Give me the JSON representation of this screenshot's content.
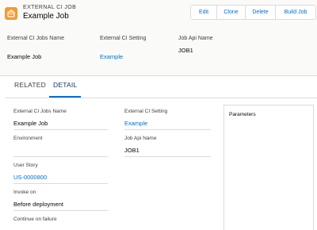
{
  "header": {
    "object_type": "EXTERNAL CI JOB",
    "record_name": "Example Job",
    "icon": "ci-job-icon",
    "buttons": {
      "edit": "Edit",
      "clone": "Clone",
      "delete": "Delete",
      "build": "Build Job"
    },
    "highlights": [
      {
        "label": "External CI Jobs Name",
        "value": "Example Job"
      },
      {
        "label": "External CI Setting",
        "value": "Example"
      },
      {
        "label": "Job Api Name",
        "value": "JOB1"
      }
    ]
  },
  "tabs": [
    {
      "label": "RELATED"
    },
    {
      "label": "DETAIL"
    }
  ],
  "detail": {
    "left": [
      {
        "label": "External CI Jobs Name",
        "value": "Example Job"
      },
      {
        "label": "Environment",
        "value": ""
      },
      {
        "label": "User Story",
        "value": "US-0000800"
      },
      {
        "label": "Invoke on",
        "value": "Before deployment"
      },
      {
        "label": "Continue on failure",
        "value": ""
      }
    ],
    "middle": [
      {
        "label": "External CI Setting",
        "value": "Example"
      },
      {
        "label": "Job Api Name",
        "value": "JOB1"
      }
    ],
    "parameters_title": "Parameters"
  },
  "colors": {
    "link": "#0070d2",
    "icon_bg": "#f59a2e",
    "active_tab": "#0070d2"
  }
}
